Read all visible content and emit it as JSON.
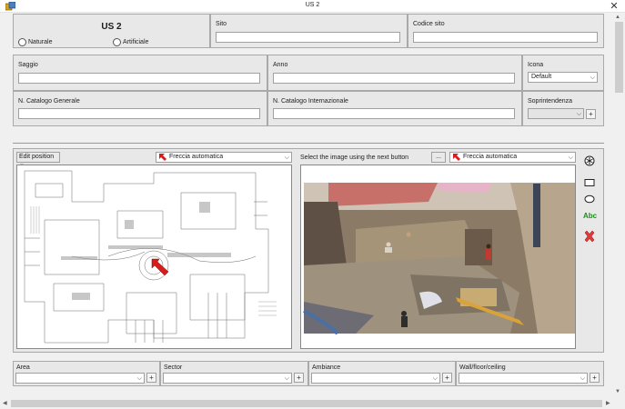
{
  "window": {
    "title": "US 2"
  },
  "header": {
    "us_title": "US 2",
    "radio_naturale": "Naturale",
    "radio_artificiale": "Artificiale",
    "sito_label": "Sito",
    "sito_value": "",
    "codice_sito_label": "Codice sito",
    "codice_sito_value": ""
  },
  "details": {
    "saggio_label": "Saggio",
    "saggio_value": "",
    "anno_label": "Anno",
    "anno_value": "",
    "icona_label": "Icona",
    "icona_value": "Default",
    "catalogo_generale_label": "N. Catalogo Generale",
    "catalogo_generale_value": "",
    "catalogo_internazionale_label": "N. Catalogo Internazionale",
    "catalogo_internazionale_value": "",
    "soprintendenza_label": "Soprintendenza",
    "soprintendenza_value": ""
  },
  "images": {
    "edit_position_label": "Edit position",
    "left_arrow_combo": "Freccia automatica",
    "select_image_label": "Select the image using the next button",
    "browse_button": "...",
    "right_arrow_combo": "Freccia automatica",
    "tools": [
      "asterisk-icon",
      "rectangle-icon",
      "ellipse-icon",
      "text-abc-icon",
      "delete-icon"
    ],
    "text_tool_label": "Abc"
  },
  "footer": {
    "area_label": "Area",
    "sector_label": "Sector",
    "ambiance_label": "Ambiance",
    "wall_label": "Wall/floor/ceiling"
  },
  "colors": {
    "accent_red": "#d81b1b",
    "abc_green": "#1f8a1f",
    "panel_bg": "#e8e8e8"
  }
}
